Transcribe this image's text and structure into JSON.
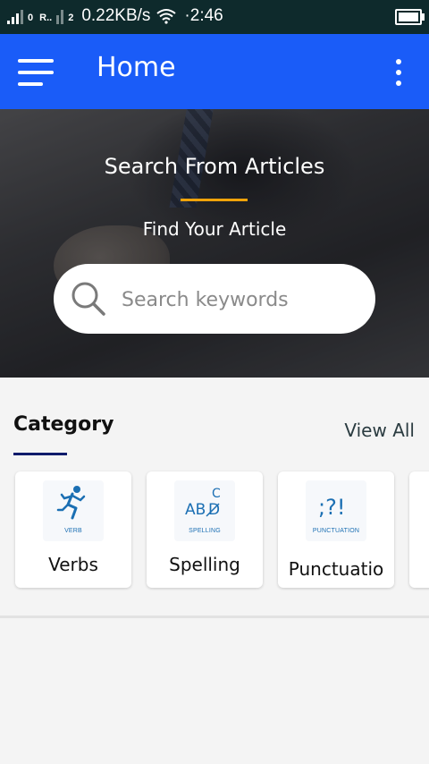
{
  "status_bar": {
    "carrier_tag_1": "0",
    "carrier_tag_2": "R..",
    "carrier_tag_3": "2",
    "speed": "0.22KB/s",
    "time": "2:46",
    "battery_level": 1.0
  },
  "app_bar": {
    "title": "Home"
  },
  "hero": {
    "title": "Search From Articles",
    "subtitle": "Find Your Article",
    "search_placeholder": "Search keywords"
  },
  "category": {
    "heading": "Category",
    "view_all": "View All",
    "cards": [
      {
        "label": "Verbs",
        "icon_text": "VERB",
        "icon": "running-figure-icon"
      },
      {
        "label": "Spelling",
        "icon_text": "SPELLING",
        "icon": "abc-spelling-icon"
      },
      {
        "label": "Punctuatio",
        "icon_text": "PUNCTUATION",
        "icon": "punctuation-icon"
      }
    ]
  },
  "colors": {
    "app_bar": "#1a5cf8",
    "accent_underline": "#f0a30a",
    "category_underline": "#0d1b6b",
    "icon_blue": "#1b6fb3"
  }
}
